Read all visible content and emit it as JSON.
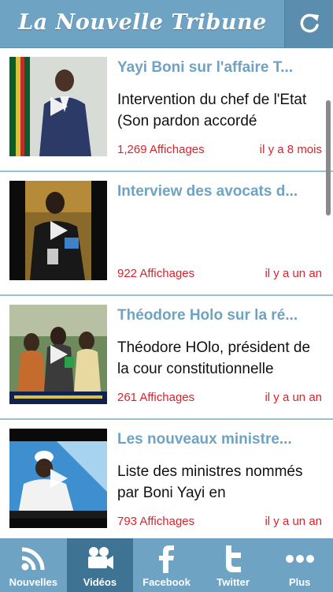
{
  "header": {
    "title": "La Nouvelle Tribune",
    "refresh_icon": "refresh-icon"
  },
  "videos": [
    {
      "title": "Yayi Boni sur l'affaire T...",
      "description": "Intervention du chef de l'Etat (Son pardon accordé",
      "views": "1,269 Affichages",
      "date": "il y a 8 mois"
    },
    {
      "title": "Interview des avocats d...",
      "description": "",
      "views": "922 Affichages",
      "date": "il y a un an"
    },
    {
      "title": "Théodore Holo sur la ré...",
      "description": "Théodore HOlo, président de la cour constitutionnelle",
      "views": "261 Affichages",
      "date": "il y a un an"
    },
    {
      "title": "Les nouveaux ministre...",
      "description": "Liste des ministres nommés par Boni Yayi en",
      "views": "793 Affichages",
      "date": "il y a un an"
    }
  ],
  "tabs": [
    {
      "label": "Nouvelles",
      "icon": "rss-icon",
      "active": false
    },
    {
      "label": "Vidéos",
      "icon": "video-camera-icon",
      "active": true
    },
    {
      "label": "Facebook",
      "icon": "facebook-icon",
      "active": false
    },
    {
      "label": "Twitter",
      "icon": "twitter-icon",
      "active": false
    },
    {
      "label": "Plus",
      "icon": "more-icon",
      "active": false
    }
  ],
  "colors": {
    "header": "#6ea3c3",
    "title_text": "#6ea3c3",
    "meta_text": "#e0202a",
    "active_tab": "#3f7393",
    "separator": "#9cbfd4"
  }
}
